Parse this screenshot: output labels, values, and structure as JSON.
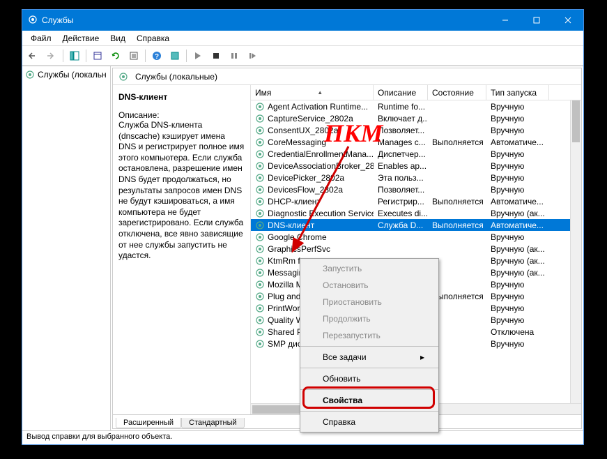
{
  "window": {
    "title": "Службы"
  },
  "menu": {
    "file": "Файл",
    "action": "Действие",
    "view": "Вид",
    "help": "Справка"
  },
  "sidebar": {
    "node": "Службы (локальн"
  },
  "right_title": "Службы (локальные)",
  "selected_service": {
    "name": "DNS-клиент",
    "desc_label": "Описание:",
    "description": "Служба DNS-клиента (dnscache) кэширует имена DNS и регистрирует полное имя этого компьютера. Если служба остановлена, разрешение имен DNS будет продолжаться, но результаты запросов имен DNS не будут кэшироваться, а имя компьютера не будет зарегистрировано. Если служба отключена, все явно зависящие от нее службы запустить не удастся."
  },
  "columns": {
    "name": "Имя",
    "desc": "Описание",
    "state": "Состояние",
    "start": "Тип запуска"
  },
  "services": [
    {
      "name": "Agent Activation Runtime...",
      "desc": "Runtime fo...",
      "state": "",
      "start": "Вручную"
    },
    {
      "name": "CaptureService_2802a",
      "desc": "Включает д...",
      "state": "",
      "start": "Вручную"
    },
    {
      "name": "ConsentUX_2802a",
      "desc": "Позволяет...",
      "state": "",
      "start": "Вручную"
    },
    {
      "name": "CoreMessaging",
      "desc": "Manages c...",
      "state": "Выполняется",
      "start": "Автоматиче..."
    },
    {
      "name": "CredentialEnrollmentMana...",
      "desc": "Диспетчер...",
      "state": "",
      "start": "Вручную"
    },
    {
      "name": "DeviceAssociationBroker_28...",
      "desc": "Enables ap...",
      "state": "",
      "start": "Вручную"
    },
    {
      "name": "DevicePicker_2802a",
      "desc": "Эта польз...",
      "state": "",
      "start": "Вручную"
    },
    {
      "name": "DevicesFlow_2802a",
      "desc": "Позволяет...",
      "state": "",
      "start": "Вручную"
    },
    {
      "name": "DHCP-клиент",
      "desc": "Регистрир...",
      "state": "Выполняется",
      "start": "Автоматиче..."
    },
    {
      "name": "Diagnostic Execution Service",
      "desc": "Executes di...",
      "state": "",
      "start": "Вручную (ак..."
    },
    {
      "name": "DNS-клиент",
      "desc": "Служба D...",
      "state": "Выполняется",
      "start": "Автоматиче..."
    },
    {
      "name": "Google Chrome",
      "desc": "",
      "state": "",
      "start": "Вручную"
    },
    {
      "name": "GraphicsPerfSvc",
      "desc": "",
      "state": "",
      "start": "Вручную (ак..."
    },
    {
      "name": "KtmRm for...",
      "desc": "",
      "state": "",
      "start": "Вручную (ак..."
    },
    {
      "name": "MessagingService",
      "desc": "",
      "state": "",
      "start": "Вручную (ак..."
    },
    {
      "name": "Mozilla Maintenance",
      "desc": "",
      "state": "",
      "start": "Вручную"
    },
    {
      "name": "Plug and Play",
      "desc": "",
      "state": "Выполняется",
      "start": "Вручную"
    },
    {
      "name": "PrintWorkflow",
      "desc": "",
      "state": "",
      "start": "Вручную"
    },
    {
      "name": "Quality Windows",
      "desc": "",
      "state": "",
      "start": "Вручную"
    },
    {
      "name": "Shared PC",
      "desc": "",
      "state": "",
      "start": "Отключена"
    },
    {
      "name": "SMP диспетчера",
      "desc": "",
      "state": "",
      "start": "Вручную"
    }
  ],
  "tabs": {
    "extended": "Расширенный",
    "standard": "Стандартный"
  },
  "statusbar": "Вывод справки для выбранного объекта.",
  "context_menu": {
    "start": "Запустить",
    "stop": "Остановить",
    "pause": "Приостановить",
    "resume": "Продолжить",
    "restart": "Перезапустить",
    "all_tasks": "Все задачи",
    "refresh": "Обновить",
    "properties": "Свойства",
    "help": "Справка"
  },
  "annotation": {
    "rmb": "ПКМ"
  }
}
